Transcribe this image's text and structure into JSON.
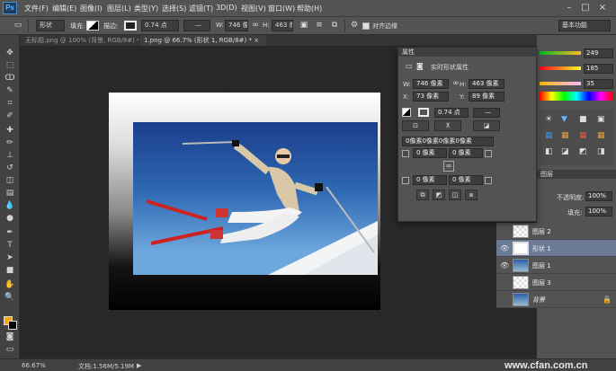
{
  "app": {
    "logo": "Ps"
  },
  "menu": [
    "文件(F)",
    "编辑(E)",
    "图像(I)",
    "图层(L)",
    "类型(Y)",
    "选择(S)",
    "滤镜(T)",
    "3D(D)",
    "视图(V)",
    "窗口(W)",
    "帮助(H)"
  ],
  "options": {
    "mode": "形状",
    "fill_label": "填充:",
    "stroke_label": "描边:",
    "stroke_width": "0.74 点",
    "w_label": "W:",
    "w_value": "746 像",
    "h_label": "H:",
    "h_value": "463 像",
    "align_edges": "对齐边缘",
    "workspace": "基本功能"
  },
  "tabs": [
    {
      "label": "无标题.png @ 100% (背景, RGB/8#) *",
      "close": "×"
    },
    {
      "label": "1.png @ 66.7% (形状 1, RGB/8#) *",
      "close": "×"
    }
  ],
  "properties": {
    "title": "属性",
    "section": "实时形状属性",
    "w_label": "W:",
    "w_value": "746 像素",
    "h_label": "H:",
    "h_value": "463 像素",
    "x_label": "X:",
    "x_value": "73 像素",
    "y_label": "Y:",
    "y_value": "89 像素",
    "stroke_width": "0.74 点",
    "corners": "0像素0像素0像素0像素",
    "r1": "0 像素",
    "r2": "0 像素",
    "r3": "0 像素",
    "r4": "0 像素"
  },
  "color": {
    "r": "249",
    "g": "185",
    "b": "35"
  },
  "layers_panel": {
    "tab": "图层",
    "opacity_label": "不透明度:",
    "opacity_value": "100%",
    "fill_label": "填充:",
    "fill_value": "100%",
    "layers": [
      {
        "name": "图层 2",
        "visible": false,
        "selected": false
      },
      {
        "name": "形状 1",
        "visible": true,
        "selected": true
      },
      {
        "name": "图层 1",
        "visible": true,
        "selected": false
      },
      {
        "name": "图层 3",
        "visible": false,
        "selected": false
      },
      {
        "name": "背景",
        "visible": false,
        "selected": false
      }
    ]
  },
  "status": {
    "zoom": "66.67%",
    "doc": "文档:1.56M/5.19M",
    "arrow": "▶"
  },
  "watermark": "www.cfan.com.cn"
}
